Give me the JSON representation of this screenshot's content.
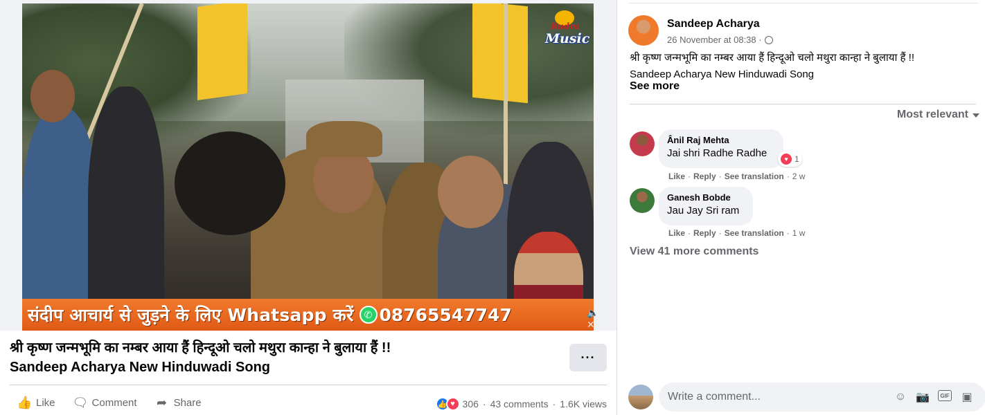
{
  "video": {
    "logo_line1": "Rudra",
    "logo_line2": "Music",
    "banner_text": "संदीप आचार्य से जुड़ने के लिए Whatsapp करें",
    "banner_phone": "08765547747",
    "whatsapp_icon": "whatsapp-icon",
    "volume_icon": "volume-muted-icon"
  },
  "post": {
    "title_line1": "श्री कृष्ण जन्मभूमि का नम्बर आया हैं हिन्दूओ चलो मथुरा कान्हा ने बुलाया हैं !!",
    "title_line2": "Sandeep Acharya New Hinduwadi Song",
    "more_label": "···",
    "actions": {
      "like": "Like",
      "comment": "Comment",
      "share": "Share"
    },
    "stats": {
      "reactions": "306",
      "comments": "43 comments",
      "views": "1.6K views",
      "separator": "·"
    }
  },
  "sidebar": {
    "author": "Sandeep Acharya",
    "timestamp": "26 November at 08:38 ·",
    "caption_line1": "श्री कृष्ण जन्मभूमि का नम्बर आया हैं हिन्दूओ चलो मथुरा कान्हा ने बुलाया हैं !!",
    "caption_line2": "Sandeep Acharya New Hinduwadi Song",
    "see_more": "See more",
    "sort_label": "Most relevant",
    "comments": [
      {
        "name": "Ânil Raj Mehta",
        "text": "Jai shri Radhe Radhe",
        "reaction_count": "1",
        "like": "Like",
        "reply": "Reply",
        "translate": "See translation",
        "age": "2 w",
        "separator": "·"
      },
      {
        "name": "Ganesh Bobde",
        "text": "Jau Jay Sri ram",
        "like": "Like",
        "reply": "Reply",
        "translate": "See translation",
        "age": "1 w",
        "separator": "·"
      }
    ],
    "view_more": "View 41 more comments",
    "write_placeholder": "Write a comment...",
    "write_icons": [
      "emoji-icon",
      "camera-icon",
      "gif-icon",
      "sticker-icon"
    ],
    "gif_label": "GIF"
  },
  "colors": {
    "accent_like": "#1877f2",
    "accent_love": "#f33e58",
    "banner": "#e86a1f",
    "secondary_text": "#65676b"
  }
}
